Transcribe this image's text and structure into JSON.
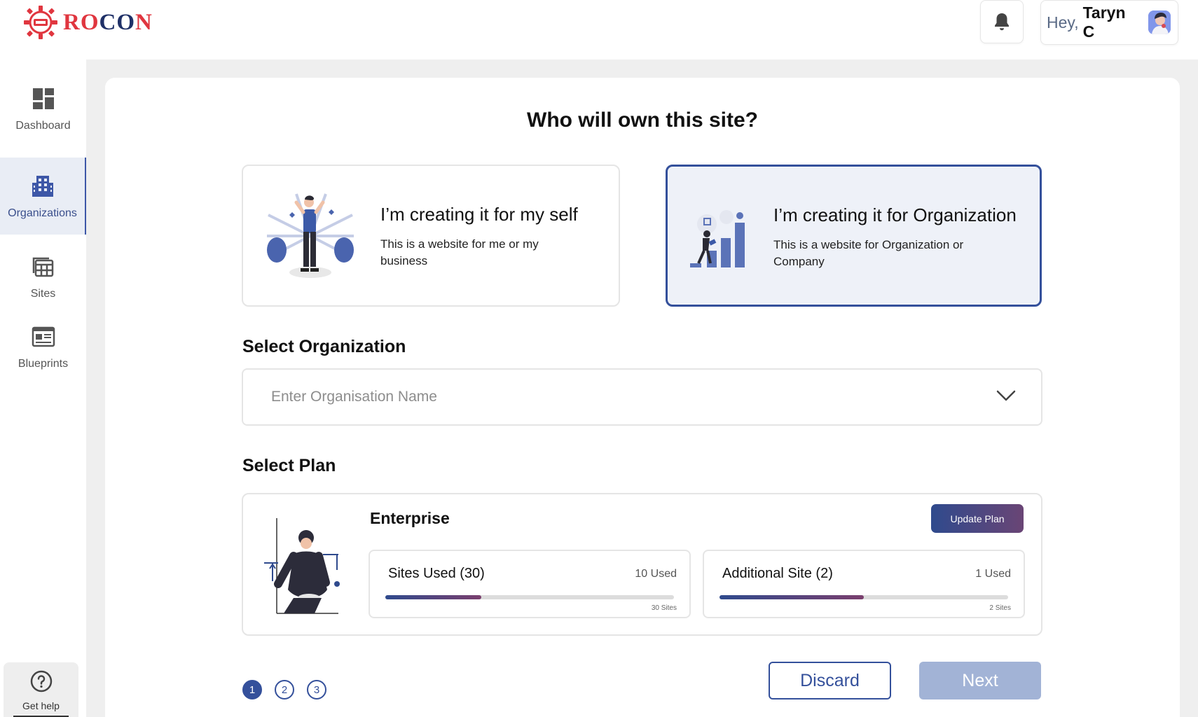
{
  "header": {
    "logo_text_a": "RO",
    "logo_text_b": "CO",
    "logo_text_c": "N",
    "greeting": "Hey,",
    "user_name": "Taryn C"
  },
  "sidebar": {
    "items": [
      {
        "label": "Dashboard",
        "icon": "dashboard-icon"
      },
      {
        "label": "Organizations",
        "icon": "building-icon",
        "active": true
      },
      {
        "label": "Sites",
        "icon": "sites-icon"
      },
      {
        "label": "Blueprints",
        "icon": "blueprint-icon"
      }
    ],
    "help_label": "Get help"
  },
  "main": {
    "title": "Who will own this site?",
    "options": [
      {
        "title": "I’m creating it for my self",
        "desc": "This is a website for me or my business",
        "selected": false
      },
      {
        "title": "I’m creating it for Organization",
        "desc": "This is a website for Organization or Company",
        "selected": true
      }
    ],
    "org_label": "Select Organization",
    "org_placeholder": "Enter Organisation Name",
    "plan_label": "Select Plan",
    "plan": {
      "name": "Enterprise",
      "update_label": "Update Plan",
      "usage": [
        {
          "title": "Sites Used (30)",
          "used": "10 Used",
          "total": "30 Sites",
          "fraction": 0.333
        },
        {
          "title": "Additional Site (2)",
          "used": "1 Used",
          "total": "2 Sites",
          "fraction": 0.5
        }
      ]
    },
    "steps": [
      "1",
      "2",
      "3"
    ],
    "discard_label": "Discard",
    "next_label": "Next"
  },
  "colors": {
    "accent": "#34509b",
    "brand_red": "#e0363f",
    "brand_navy": "#1f3067",
    "next_disabled": "#a2b3d6"
  }
}
